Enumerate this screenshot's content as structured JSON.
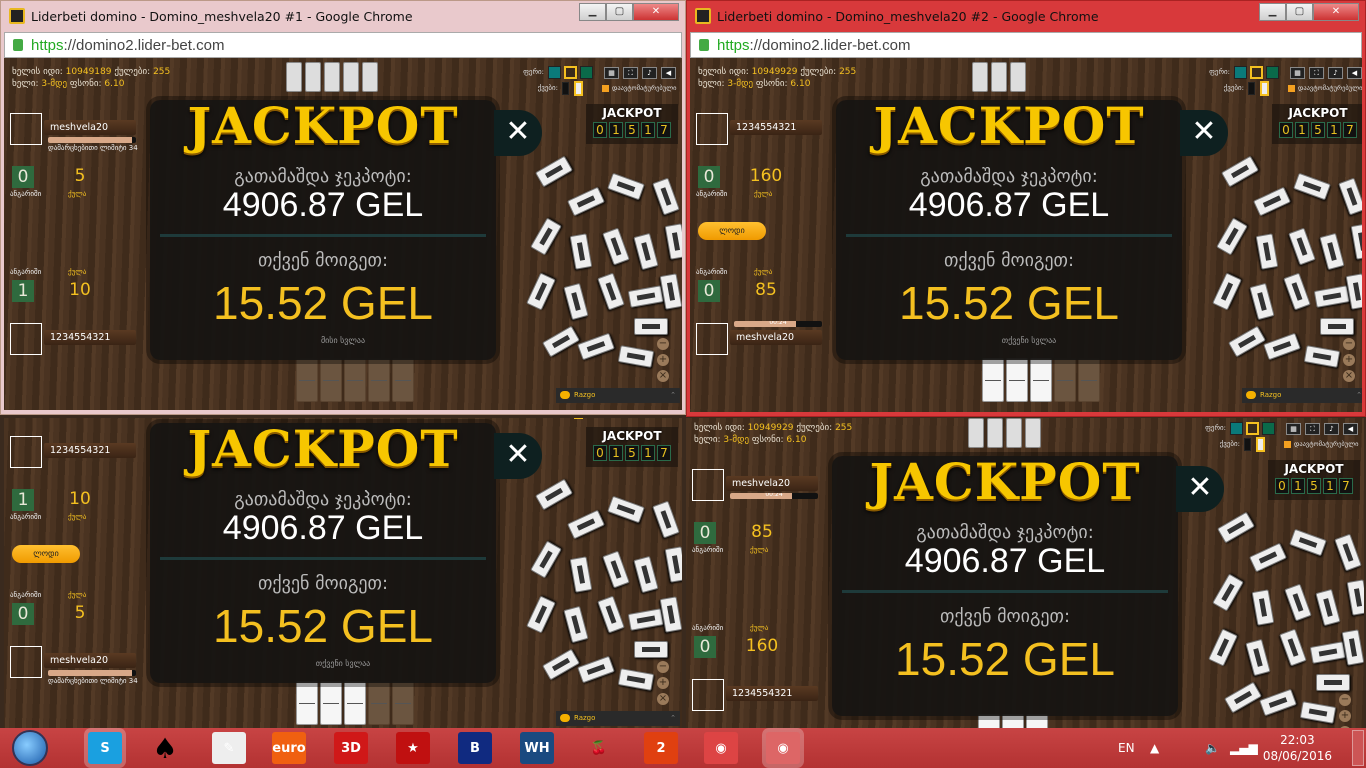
{
  "shared": {
    "jackpot_title": "JACKPOT",
    "jackpot_drawn_label": "გათამაშდა ჯეკპოტი:",
    "jackpot_amount": "4906.87 GEL",
    "you_won_label": "თქვენ მოიგეთ:",
    "won_amount": "15.52 GEL",
    "close_symbol": "✕",
    "jackpot_panel_title": "JACKPOT",
    "jackpot_counter": [
      "0",
      "1",
      "5",
      "1",
      "7"
    ],
    "game_id_label": "ხელის იდი:",
    "points_label": "ქულები:",
    "hand_label": "ხელი:",
    "hand_value": "3-მდე",
    "bet_label": "ფსონი:",
    "bet_value": "6.10",
    "color_label": "ფერი:",
    "tile_label": "ქვები:",
    "auto_label": "დაავტომატურებული",
    "score_label": "ანგარიში",
    "pts_label": "ქულა",
    "chat_label": "Razgo",
    "accent": "#f4c020"
  },
  "windows": [
    {
      "title": "Liderbeti domino - Domino_meshvela20 #1 - Google Chrome",
      "url_scheme": "https",
      "url_rest": "://domino2.lider-bet.com",
      "game_id": "10949189",
      "points": "255",
      "top_player": {
        "name": "meshvela20",
        "sub": "დამარცხებითი ლიმიტი 34"
      },
      "top_score": "0",
      "top_pts": "5",
      "bottom_score": "1",
      "bottom_pts": "10",
      "bottom_player": {
        "name": "1234554321"
      },
      "turn": "მისი სვლაა"
    },
    {
      "title": "Liderbeti domino - Domino_meshvela20 #2 - Google Chrome",
      "url_scheme": "https",
      "url_rest": "://domino2.lider-bet.com",
      "game_id": "10949929",
      "points": "255",
      "top_player": {
        "name": "1234554321"
      },
      "top_score": "0",
      "top_pts": "160",
      "wait_button": "ლოდი",
      "bottom_score": "0",
      "bottom_pts": "85",
      "bottom_player": {
        "name": "meshvela20",
        "timer": "00:24"
      },
      "turn": "თქვენი სვლაა"
    },
    {
      "game_id": "",
      "points": "",
      "top_player": {
        "name": "1234554321"
      },
      "top_score": "1",
      "top_pts": "10",
      "wait_button": "ლოდი",
      "bottom_score": "0",
      "bottom_pts": "5",
      "bottom_player": {
        "name": "meshvela20",
        "sub": "დამარცხებითი ლიმიტი 34"
      },
      "turn": "თქვენი სვლაა"
    },
    {
      "game_id": "10949929",
      "points": "255",
      "top_player": {
        "name": "meshvela20",
        "timer": "00:24"
      },
      "top_score": "0",
      "top_pts": "85",
      "bottom_score": "0",
      "bottom_pts": "160",
      "bottom_player": {
        "name": "1234554321"
      },
      "turn": ""
    }
  ],
  "taskbar": {
    "apps": [
      {
        "name": "skype",
        "label": "S",
        "color": "#1aa0e0"
      },
      {
        "name": "spade",
        "label": "♠",
        "color": "transparent"
      },
      {
        "name": "app-red-green",
        "label": "✎",
        "color": "#eee"
      },
      {
        "name": "euro",
        "label": "euro",
        "color": "#f06010"
      },
      {
        "name": "3d-poker",
        "label": "3D",
        "color": "#d01818"
      },
      {
        "name": "pokerstars",
        "label": "★",
        "color": "#c01010"
      },
      {
        "name": "b-app",
        "label": "B",
        "color": "#102a80"
      },
      {
        "name": "wh-app",
        "label": "WH",
        "color": "#1a4a80"
      },
      {
        "name": "cherries",
        "label": "🍒",
        "color": "transparent"
      },
      {
        "name": "2-app",
        "label": "2",
        "color": "#e04010"
      },
      {
        "name": "chrome-1",
        "label": "◉",
        "color": "#d44"
      },
      {
        "name": "chrome-2",
        "label": "◉",
        "color": "#d66"
      }
    ],
    "language": "EN",
    "time": "22:03",
    "date": "08/06/2016"
  }
}
